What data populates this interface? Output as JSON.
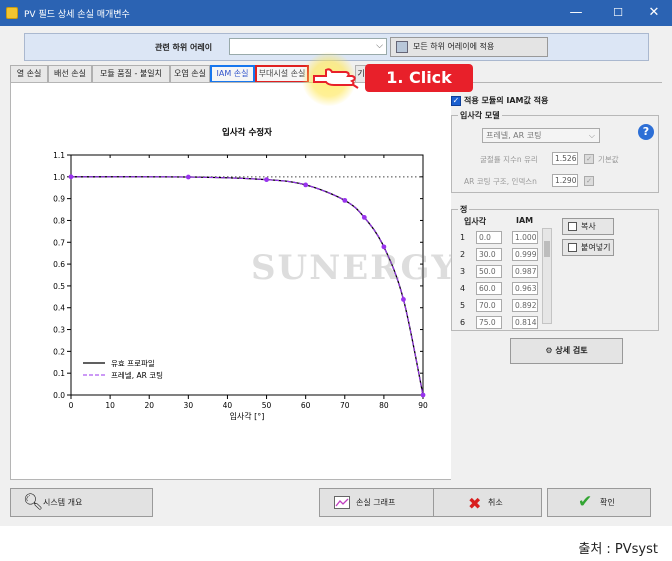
{
  "window": {
    "title": "PV 필드 상세 손실 매개변수",
    "min": "—",
    "max": "☐",
    "close": "✕"
  },
  "array_bar": {
    "label": "관련 하위 어레이",
    "combo_value": "",
    "apply_label": "모든 하위 어레이에 적용"
  },
  "tabs": [
    {
      "label": "열 손실"
    },
    {
      "label": "배선 손실"
    },
    {
      "label": "모듈 품질 - 불일치"
    },
    {
      "label": "오염 손실"
    },
    {
      "label": "IAM 손실"
    },
    {
      "label": "부대시설 손실"
    },
    {
      "label": "기"
    }
  ],
  "annotation": {
    "click_label": "1. Click"
  },
  "right": {
    "use_module_iam": "적용 모듈의 IAM값 적용",
    "model_group_title": "입사각 모델",
    "model_value": "프레넬, AR 코팅",
    "glass_index_label": "굴절률 지수n 유리",
    "glass_index_value": "1.526",
    "default_label": "기본값",
    "ar_index_label": "AR 코팅 구조, 인덱스n",
    "ar_index_value": "1.290",
    "table_group_title": "정",
    "col_angle": "입사각",
    "col_iam": "IAM",
    "rows": [
      {
        "idx": "1",
        "angle": "0.0",
        "iam": "1.000"
      },
      {
        "idx": "2",
        "angle": "30.0",
        "iam": "0.999"
      },
      {
        "idx": "3",
        "angle": "50.0",
        "iam": "0.987"
      },
      {
        "idx": "4",
        "angle": "60.0",
        "iam": "0.963"
      },
      {
        "idx": "5",
        "angle": "70.0",
        "iam": "0.892"
      },
      {
        "idx": "6",
        "angle": "75.0",
        "iam": "0.814"
      }
    ],
    "copy_label": "복사",
    "paste_label": "붙여넣기",
    "review_label": "상세 검토"
  },
  "buttons": {
    "overview": "시스템 개요",
    "graph": "손실 그래프",
    "cancel": "취소",
    "ok": "확인"
  },
  "footer": {
    "source": "출처 : PVsyst"
  },
  "watermark": "SUNERGY",
  "colors": {
    "titlebar": "#2b63b3",
    "series_user": "#000000",
    "series_fresnel": "#9933ee",
    "badge": "#e8202a"
  },
  "chart_data": {
    "type": "line",
    "title": "입사각 수정자",
    "xlabel": "입사각 [°]",
    "ylabel": "",
    "xlim": [
      0,
      90
    ],
    "ylim": [
      0,
      1.1
    ],
    "x_ticks": [
      0,
      10,
      20,
      30,
      40,
      50,
      60,
      70,
      80,
      90
    ],
    "y_ticks": [
      0,
      0.1,
      0.2,
      0.3,
      0.4,
      0.5,
      0.6,
      0.7,
      0.8,
      0.9,
      1.0,
      1.1
    ],
    "reference_line": 1.0,
    "legend_position": "bottom-left",
    "series": [
      {
        "name": "유효 프로파일",
        "style": "solid",
        "color": "#000000",
        "x": [
          0,
          30,
          50,
          60,
          70,
          75,
          80,
          85,
          90
        ],
        "y": [
          1.0,
          0.999,
          0.987,
          0.963,
          0.892,
          0.814,
          0.679,
          0.438,
          0.0
        ]
      },
      {
        "name": "프레넬, AR 코팅",
        "style": "dashed",
        "color": "#9933ee",
        "x": [
          0,
          30,
          50,
          60,
          70,
          75,
          80,
          85,
          90
        ],
        "y": [
          1.0,
          0.999,
          0.987,
          0.963,
          0.892,
          0.814,
          0.679,
          0.438,
          0.0
        ]
      }
    ]
  }
}
